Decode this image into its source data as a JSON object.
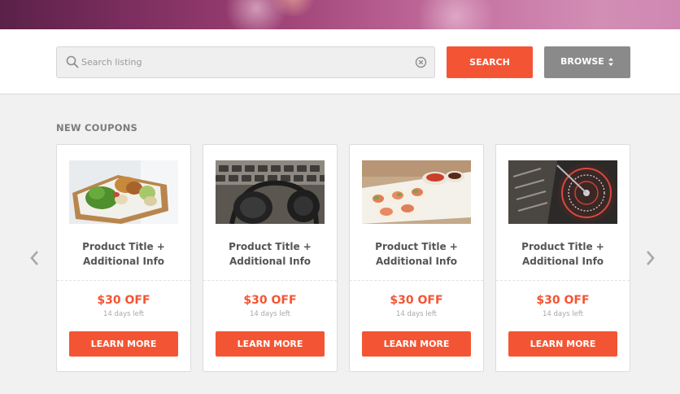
{
  "search": {
    "placeholder": "Search listing",
    "value": "",
    "search_label": "SEARCH",
    "browse_label": "BROWSE"
  },
  "section": {
    "title": "NEW COUPONS"
  },
  "navigation": {
    "prev_icon": "chevron-left-icon",
    "next_icon": "chevron-right-icon"
  },
  "coupons": [
    {
      "image": "bento-lunch-box-photo",
      "title_line1": "Product Title +",
      "title_line2": "Additional Info",
      "discount": "$30 OFF",
      "time_left": "14 days left",
      "cta": "LEARN MORE"
    },
    {
      "image": "headphones-keyboard-photo",
      "title_line1": "Product Title +",
      "title_line2": "Additional Info",
      "discount": "$30 OFF",
      "time_left": "14 days left",
      "cta": "LEARN MORE"
    },
    {
      "image": "spring-rolls-photo",
      "title_line1": "Product Title +",
      "title_line2": "Additional Info",
      "discount": "$30 OFF",
      "time_left": "14 days left",
      "cta": "LEARN MORE"
    },
    {
      "image": "dj-turntable-photo",
      "title_line1": "Product Title +",
      "title_line2": "Additional Info",
      "discount": "$30 OFF",
      "time_left": "14 days left",
      "cta": "LEARN MORE"
    }
  ],
  "colors": {
    "accent": "#f35534",
    "browse_button": "#8a8a8a",
    "page_background": "#f1f1f1"
  }
}
